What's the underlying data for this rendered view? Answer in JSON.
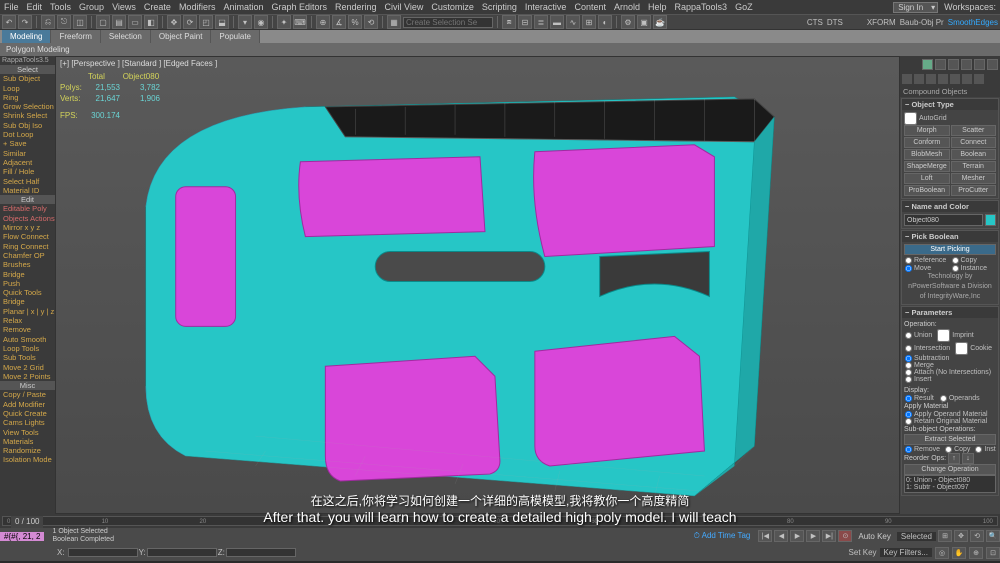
{
  "menu": [
    "File",
    "Edit",
    "Tools",
    "Group",
    "Views",
    "Create",
    "Modifiers",
    "Animation",
    "Graph Editors",
    "Rendering",
    "Civil View",
    "Customize",
    "Scripting",
    "Interactive",
    "Content",
    "Arnold",
    "Help",
    "RappaTools3",
    "GoZ"
  ],
  "signin": "Sign In",
  "workspaces": "Workspaces:",
  "selset_placeholder": "Create Selection Se",
  "toolbar_right": {
    "cts": "CTS",
    "dts": "DTS",
    "xform": "XFORM",
    "baub": "Baub-Obj Pr",
    "smooth": "SmoothEdges"
  },
  "ribbon_tabs": [
    "Modeling",
    "Freeform",
    "Selection",
    "Object Paint",
    "Populate"
  ],
  "ribbon_sub": "Polygon Modeling",
  "left_panel": {
    "header": "RappaTools3.5",
    "header2": "Select",
    "items": [
      {
        "t": "Sub Object",
        "c": "gold"
      },
      {
        "t": "Loop",
        "c": "gold"
      },
      {
        "t": "Ring",
        "c": "gold"
      },
      {
        "t": "Grow Selection",
        "c": "gold"
      },
      {
        "t": "Shrink Select",
        "c": "gold"
      },
      {
        "t": "Sub Obj Iso",
        "c": "gold"
      },
      {
        "t": "Dot Loop",
        "c": "gold"
      },
      {
        "t": "+ Save",
        "c": "gold"
      },
      {
        "t": "Similar",
        "c": "gold"
      },
      {
        "t": "Adjacent",
        "c": "gold"
      },
      {
        "t": "Fill / Hole",
        "c": "gold"
      },
      {
        "t": "Select Half",
        "c": "gold"
      },
      {
        "t": "Material ID",
        "c": "gold"
      },
      {
        "t": "Edit",
        "c": "section"
      },
      {
        "t": "Editable Poly",
        "c": "red"
      },
      {
        "t": "Objects Actions",
        "c": "red"
      },
      {
        "t": "Mirror  x  y  z",
        "c": "gold"
      },
      {
        "t": "Flow Connect",
        "c": "gold"
      },
      {
        "t": "Ring Connect",
        "c": "gold"
      },
      {
        "t": "Chamfer OP",
        "c": "gold"
      },
      {
        "t": "Brushes",
        "c": "gold"
      },
      {
        "t": "Bridge",
        "c": "gold"
      },
      {
        "t": "Push",
        "c": "gold"
      },
      {
        "t": "Quick Tools",
        "c": "gold"
      },
      {
        "t": "Bridge",
        "c": "gold"
      },
      {
        "t": "Planar | x | y | z",
        "c": "gold"
      },
      {
        "t": "Relax",
        "c": "gold"
      },
      {
        "t": "Remove",
        "c": "gold"
      },
      {
        "t": "Auto Smooth",
        "c": "gold"
      },
      {
        "t": "Loop Tools",
        "c": "gold"
      },
      {
        "t": "Sub Tools",
        "c": "gold"
      },
      {
        "t": "Move 2 Grid",
        "c": "gold"
      },
      {
        "t": "Move 2 Points",
        "c": "gold"
      },
      {
        "t": "Misc",
        "c": "section"
      },
      {
        "t": "Copy / Paste",
        "c": "gold"
      },
      {
        "t": "Add Modifier",
        "c": "gold"
      },
      {
        "t": "Quick Create",
        "c": "gold"
      },
      {
        "t": "Cams Lights",
        "c": "gold"
      },
      {
        "t": "View Tools",
        "c": "gold"
      },
      {
        "t": "Materials",
        "c": "gold"
      },
      {
        "t": "Randomize",
        "c": "gold"
      },
      {
        "t": "Isolation Mode",
        "c": "gold"
      }
    ]
  },
  "viewport": {
    "label": "[+] [Perspective ] [Standard ] [Edged Faces ]",
    "object": "Object080",
    "stats": {
      "polys_total": "21,553",
      "polys_obj": "3,782",
      "verts_total": "21,647",
      "verts_obj": "1,906",
      "fps": "300.174"
    }
  },
  "right_panel": {
    "title": "Compound Objects",
    "object_type": {
      "header": "Object Type",
      "autogrid": "AutoGrid",
      "buttons": [
        [
          "Morph",
          "Scatter"
        ],
        [
          "Conform",
          "Connect"
        ],
        [
          "BlobMesh",
          "Boolean"
        ],
        [
          "ShapeMerge",
          "Terrain"
        ],
        [
          "Loft",
          "Mesher"
        ],
        [
          "ProBoolean",
          "ProCutter"
        ]
      ]
    },
    "name_color": {
      "header": "Name and Color",
      "value": "Object080"
    },
    "pick_boolean": {
      "header": "Pick Boolean",
      "start": "Start Picking",
      "ref": "Reference",
      "copy": "Copy",
      "move": "Move",
      "inst": "Instance",
      "tech": [
        "Technology by",
        "nPowerSoftware a Division",
        "of IntegrityWare,Inc"
      ]
    },
    "parameters": {
      "header": "Parameters",
      "op_label": "Operation:",
      "ops": [
        [
          "Union",
          "Imprint"
        ],
        [
          "Intersection",
          "Cookie"
        ],
        [
          "Subtraction",
          ""
        ],
        [
          "Merge",
          ""
        ],
        [
          "Attach (No Intersections)",
          ""
        ],
        [
          "Insert",
          ""
        ]
      ],
      "display": "Display:",
      "result": "Result",
      "operands": "Operands",
      "apply_mat": "Apply Material",
      "apply_op": "Apply Operand Material",
      "retain": "Retain Original Material",
      "subobj": "Sub-object Operations:",
      "extract": "Extract Selected",
      "remove": "Remove",
      "copy2": "Copy",
      "inst2": "Inst",
      "reorder": "Reorder Ops:",
      "change": "Change Operation",
      "list": [
        "0: Union - Object080",
        "1: Subtr - Object097"
      ]
    }
  },
  "timeline": {
    "frame": "0 / 100"
  },
  "subtitle": {
    "cn": "在这之后,你将学习如何创建一个详细的高模模型,我将教你一个高度精简",
    "en": "After that. you will learn how to create a detailed high poly model. I will teach"
  },
  "status": {
    "selected": "1 Object Selected",
    "completed": "Boolean Completed",
    "prompt": "#{#{, 21, 2",
    "addtag": "Add Time Tag",
    "autokey": "Auto Key",
    "selected2": "Selected",
    "setkey": "Set Key",
    "keyfilters": "Key Filters..."
  }
}
